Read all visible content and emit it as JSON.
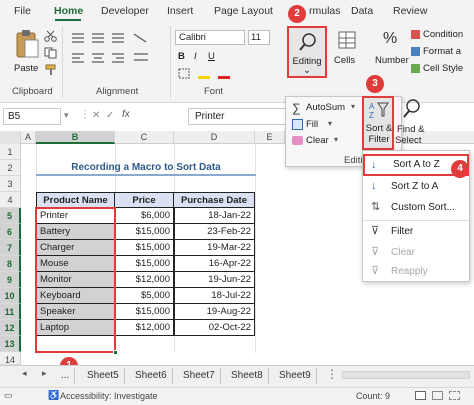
{
  "tabs": [
    "File",
    "Home",
    "Developer",
    "Insert",
    "Page Layout",
    "rmulas",
    "Data",
    "Review"
  ],
  "clipboard": {
    "paste_label": "Paste",
    "group_label": "Clipboard"
  },
  "font": {
    "name": "Calibri",
    "size": "11",
    "bold": "B",
    "italic": "I",
    "underline": "U",
    "group_label": "Font"
  },
  "alignment": {
    "group_label": "Alignment"
  },
  "editing": {
    "label": "Editing",
    "arrow": "⌄"
  },
  "cells": {
    "label": "Cells"
  },
  "number": {
    "label": "Number",
    "percent": "%"
  },
  "styles": {
    "items": [
      "Condition",
      "Format a",
      "Cell Style"
    ]
  },
  "badges": [
    "1",
    "2",
    "3",
    "4"
  ],
  "namebox": "B5",
  "formula_value": "Printer",
  "fx": "fx",
  "columns": [
    "A",
    "B",
    "C",
    "D",
    "E"
  ],
  "rows": [
    "1",
    "2",
    "3",
    "4",
    "5",
    "6",
    "7",
    "8",
    "9",
    "10",
    "11",
    "12",
    "13",
    "14"
  ],
  "table": {
    "title": "Recording a Macro to Sort Data",
    "headers": [
      "Product Name",
      "Price",
      "Purchase Date"
    ],
    "rows": [
      {
        "name": "Printer",
        "price": "$6,000",
        "date": "18-Jan-22"
      },
      {
        "name": "Battery",
        "price": "$15,000",
        "date": "23-Feb-22"
      },
      {
        "name": "Charger",
        "price": "$15,000",
        "date": "19-Mar-22"
      },
      {
        "name": "Mouse",
        "price": "$15,000",
        "date": "16-Apr-22"
      },
      {
        "name": "Monitor",
        "price": "$12,000",
        "date": "19-Jun-22"
      },
      {
        "name": "Keyboard",
        "price": "$5,000",
        "date": "18-Jul-22"
      },
      {
        "name": "Speaker",
        "price": "$15,000",
        "date": "19-Aug-22"
      },
      {
        "name": "Laptop",
        "price": "$12,000",
        "date": "02-Oct-22"
      }
    ]
  },
  "editing_panel": {
    "autosum": "AutoSum",
    "fill": "Fill",
    "clear": "Clear",
    "sort_filter": [
      "Sort &",
      "Filter"
    ],
    "find_select": [
      "Find &",
      "Select"
    ],
    "group_label": "Editi"
  },
  "sort_menu": {
    "items": [
      "Sort A to Z",
      "Sort Z to A",
      "Custom Sort...",
      "Filter",
      "Clear",
      "Reapply"
    ]
  },
  "sheet_tabs": [
    "...",
    "Sheet5",
    "Sheet6",
    "Sheet7",
    "Sheet8",
    "Sheet9"
  ],
  "status": {
    "accessibility": "Accessibility: Investigate",
    "count": "Count: 9"
  },
  "colors": {
    "accent": "#1e6b3a",
    "highlight": "#e03c3c",
    "header_fill": "#d9e1f2"
  }
}
